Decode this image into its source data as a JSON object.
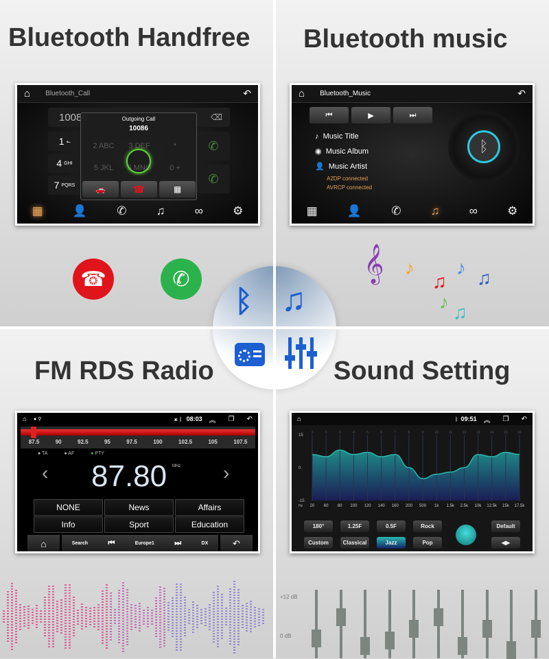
{
  "panels": {
    "handfree": {
      "title": "Bluetooth Handfree",
      "app_title": "Bluetooth_Call",
      "number_field": "10086",
      "dialog_title": "Outgoing Call",
      "dialog_number": "10086",
      "keys": [
        {
          "d": "1",
          "l": "ـه"
        },
        {
          "d": "4",
          "l": "GHI"
        },
        {
          "d": "7",
          "l": "PQRS"
        }
      ],
      "dim_keys": [
        "2 ABC",
        "3 DEF",
        "*",
        "5 JKL",
        "6 MNO",
        "0 +"
      ]
    },
    "music": {
      "title": "Bluetooth music",
      "app_title": "Bluetooth_Music",
      "track_title": "Music Title",
      "album": "Music Album",
      "artist": "Music Artist",
      "status1": "A2DP connected",
      "status2": "AVRCP connected"
    },
    "radio": {
      "title": "FM RDS Radio",
      "clock": "08:03",
      "scale": [
        "87.5",
        "90",
        "92.5",
        "95",
        "97.5",
        "100",
        "102.5",
        "105",
        "107.5"
      ],
      "flags": [
        "TA",
        "AF",
        "PTY"
      ],
      "frequency": "87.80",
      "unit": "MHz",
      "tuned_fraction": 0.015,
      "pty": [
        "NONE",
        "News",
        "Affairs",
        "Info",
        "Sport",
        "Education"
      ],
      "bottom": {
        "search": "Search",
        "station": "Europe1",
        "dx": "DX"
      }
    },
    "sound": {
      "title": "Sound Setting",
      "clock": "09:51",
      "band_numbers": [
        "1",
        "2",
        "3",
        "4",
        "5",
        "6",
        "7",
        "8",
        "9",
        "10",
        "11",
        "12",
        "13",
        "14",
        "15",
        "16"
      ],
      "y_labels": [
        "15",
        "0",
        "-15"
      ],
      "hz_label": "Hz",
      "freqs": [
        "20",
        "60",
        "80",
        "100",
        "120",
        "140",
        "160",
        "200",
        "500",
        "1k",
        "1.5k",
        "2.5k",
        "10k",
        "12.5k",
        "15k",
        "17.5k"
      ],
      "levels_db": [
        6,
        5,
        8,
        6,
        7,
        5,
        6,
        0,
        -5,
        -3,
        -2,
        0,
        6,
        5,
        7,
        6
      ],
      "buttons": [
        "180°",
        "1.25F",
        "0.5F",
        "Rock",
        "Custom",
        "Classical",
        "Jazz",
        "Pop"
      ],
      "selected": "Jazz",
      "default_label": "Default",
      "accent": "#2bb8b0"
    }
  },
  "deco_sliders": {
    "labels": [
      "+12 dB",
      "0 dB"
    ],
    "levels": [
      0.3,
      0.85,
      0.1,
      0.25,
      0.55,
      0.85,
      0.1,
      0.55,
      0.0,
      0.55
    ]
  },
  "colors": {
    "bt_blue": "#1c5fd1",
    "hangup": "#e0141b",
    "call": "#2bb24c",
    "orange": "#e8a25a"
  }
}
